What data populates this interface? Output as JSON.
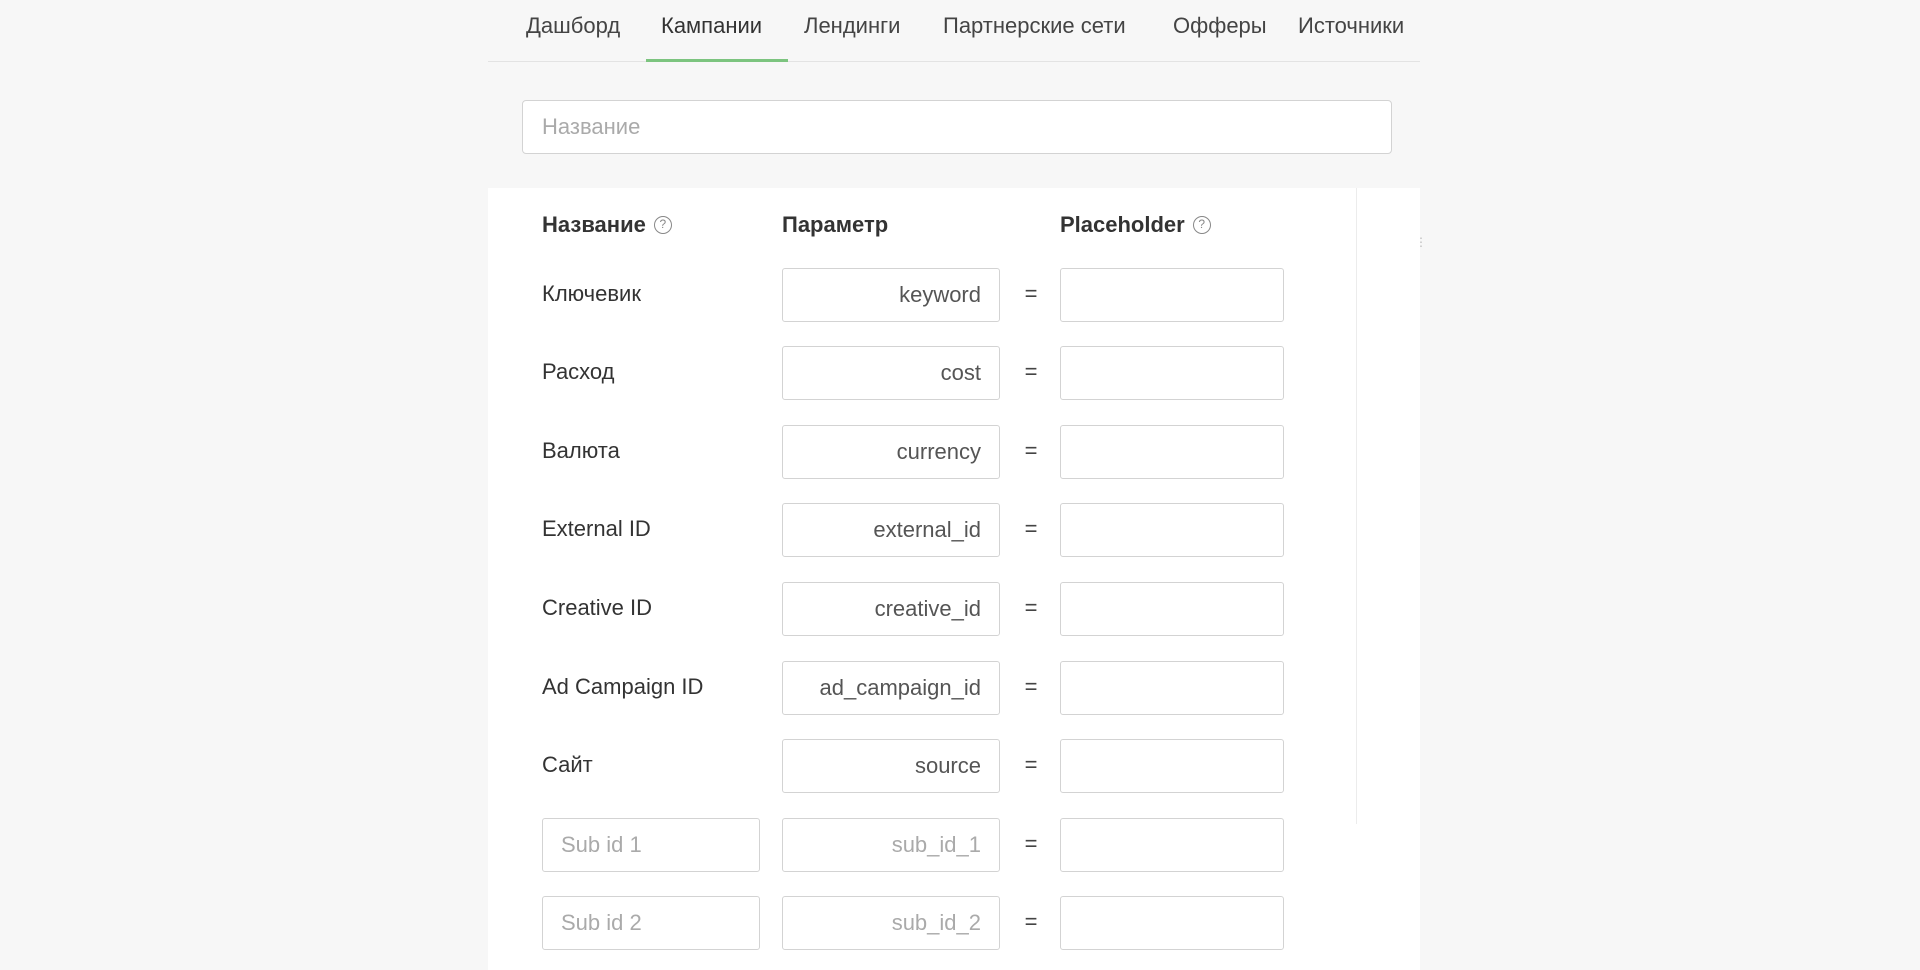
{
  "nav": {
    "tabs": [
      {
        "label": "Дашборд"
      },
      {
        "label": "Кампании"
      },
      {
        "label": "Лендинги"
      },
      {
        "label": "Партнерские сети"
      },
      {
        "label": "Офферы"
      },
      {
        "label": "Источники"
      }
    ],
    "active_tab": "Кампании",
    "accent_color": "#7cc47f"
  },
  "name_input": {
    "placeholder": "Название",
    "value": ""
  },
  "table": {
    "headers": {
      "name": "Название",
      "param": "Параметр",
      "placeholder": "Placeholder"
    },
    "equals": "=",
    "rows": [
      {
        "name": "Ключевик",
        "param": "keyword",
        "placeholder": ""
      },
      {
        "name": "Расход",
        "param": "cost",
        "placeholder": ""
      },
      {
        "name": "Валюта",
        "param": "currency",
        "placeholder": ""
      },
      {
        "name": "External ID",
        "param": "external_id",
        "placeholder": ""
      },
      {
        "name": "Creative ID",
        "param": "creative_id",
        "placeholder": ""
      },
      {
        "name": "Ad Campaign ID",
        "param": "ad_campaign_id",
        "placeholder": ""
      },
      {
        "name": "Сайт",
        "param": "source",
        "placeholder": ""
      }
    ],
    "sub_rows": [
      {
        "name_placeholder": "Sub id 1",
        "param_placeholder": "sub_id_1",
        "placeholder": ""
      },
      {
        "name_placeholder": "Sub id 2",
        "param_placeholder": "sub_id_2",
        "placeholder": ""
      }
    ]
  },
  "icons": {
    "help": "question-circle-icon",
    "help_glyph": "?"
  }
}
